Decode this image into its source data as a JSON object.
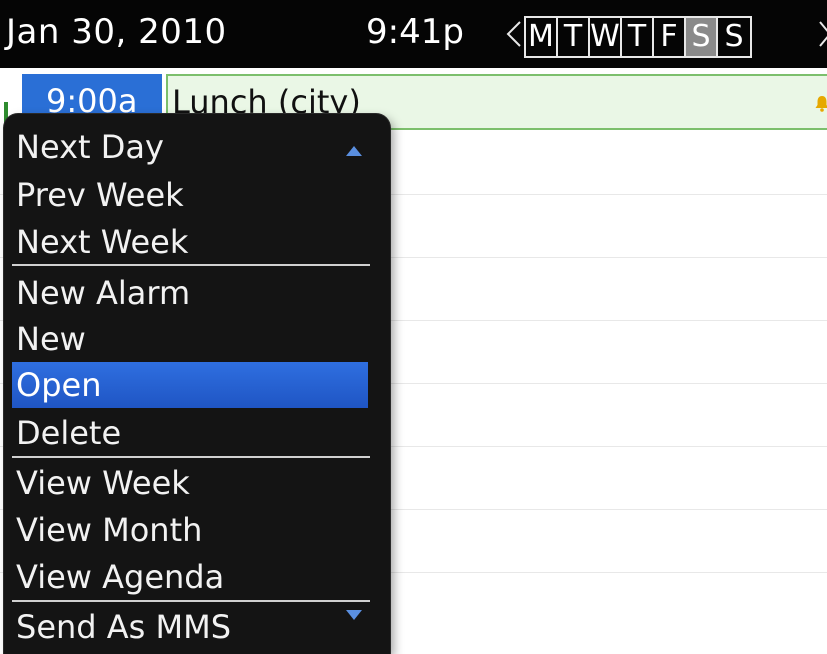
{
  "header": {
    "date": "Jan 30, 2010",
    "time": "9:41p",
    "weekdays": [
      "M",
      "T",
      "W",
      "T",
      "F",
      "S",
      "S"
    ],
    "selected_day_index": 5,
    "prev_icon": "chevron-left-icon",
    "next_icon": "chevron-right-icon"
  },
  "dayview": {
    "slot_time": "9:00a",
    "event": {
      "title": "Lunch (city)",
      "icon": "alarm-bell-icon"
    }
  },
  "menu": {
    "items": [
      {
        "label": "Next Day"
      },
      {
        "label": "Prev Week"
      },
      {
        "label": "Next Week"
      },
      {
        "label": "New Alarm"
      },
      {
        "label": "New"
      },
      {
        "label": "Open",
        "selected": true
      },
      {
        "label": "Delete"
      },
      {
        "label": "View Week"
      },
      {
        "label": "View Month"
      },
      {
        "label": "View Agenda"
      },
      {
        "label": "Send As MMS"
      }
    ],
    "scroll_up_icon": "scroll-up-arrow-icon",
    "scroll_down_icon": "scroll-down-arrow-icon"
  },
  "colors": {
    "header_bg": "#050505",
    "selection_blue": "#2a6fd6",
    "event_bg": "#eaf7e6",
    "event_border": "#7cbf6c",
    "menu_bg": "#141414",
    "alarm_icon": "#e6a800"
  }
}
